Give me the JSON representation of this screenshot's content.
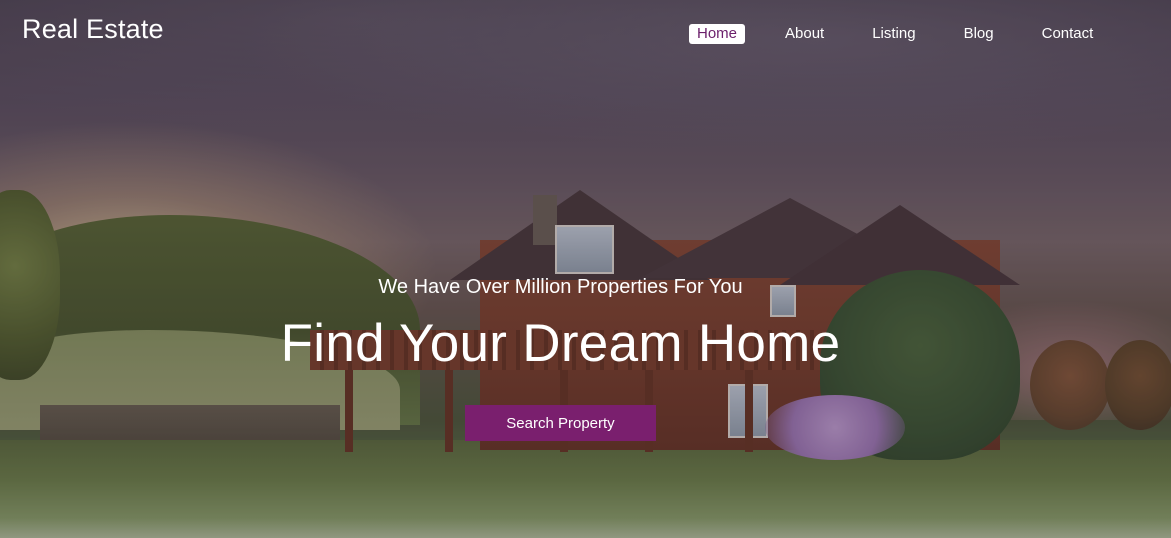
{
  "brand": {
    "title": "Real Estate"
  },
  "nav": {
    "items": [
      {
        "label": "Home",
        "active": true
      },
      {
        "label": "About",
        "active": false
      },
      {
        "label": "Listing",
        "active": false
      },
      {
        "label": "Blog",
        "active": false
      },
      {
        "label": "Contact",
        "active": false
      }
    ]
  },
  "hero": {
    "subtitle": "We Have Over Million Properties For You",
    "headline": "Find Your Dream Home",
    "cta_label": "Search Property"
  },
  "colors": {
    "accent": "#7a1f6e",
    "active_nav_text": "#6b1f6b",
    "text": "#ffffff"
  }
}
